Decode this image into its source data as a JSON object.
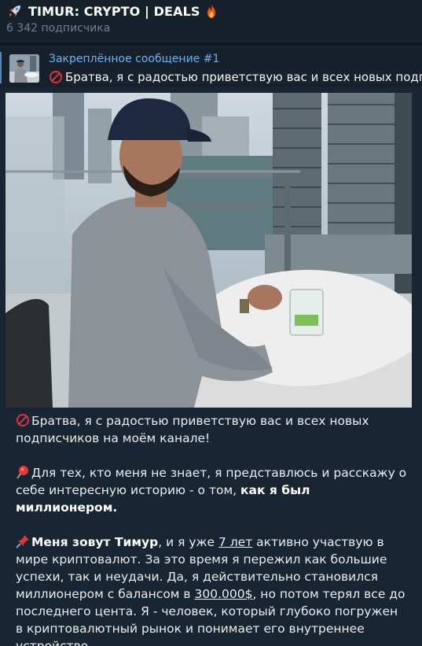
{
  "channel": {
    "title": "TIMUR: CRYPTO | DEALS",
    "subscribers": "6 342 подписчика",
    "title_icons": [
      "rocket-icon",
      "fire-icon"
    ]
  },
  "pinned": {
    "label": "Закреплённое сообщение #1",
    "preview": "Братва, я с радостью приветствую вас и всех новых подписчиков на моём канале!"
  },
  "message": {
    "p1": "Братва, я с радостью приветствую вас и всех новых подписчиков на моём канале!",
    "p2_text": "Для тех, кто меня не знает, я представлюсь и расскажу о себе интересную историю - о том, ",
    "p2_bold": "как я был миллионером.",
    "p3_bold": "Меня зовут Тимур",
    "p3_a": ", и я уже ",
    "p3_years": "7 лет",
    "p3_b": " активно участвую в мире криптовалют. За это время я пережил как большие успехи, так и неудачи. Да, я действительно становился миллионером с балансом в ",
    "p3_balance": "300.000$",
    "p3_c": ", но потом терял все до последнего цента. Я - человек, который глубоко погружен в криптовалютный рынок и понимает его внутреннее устройство."
  }
}
